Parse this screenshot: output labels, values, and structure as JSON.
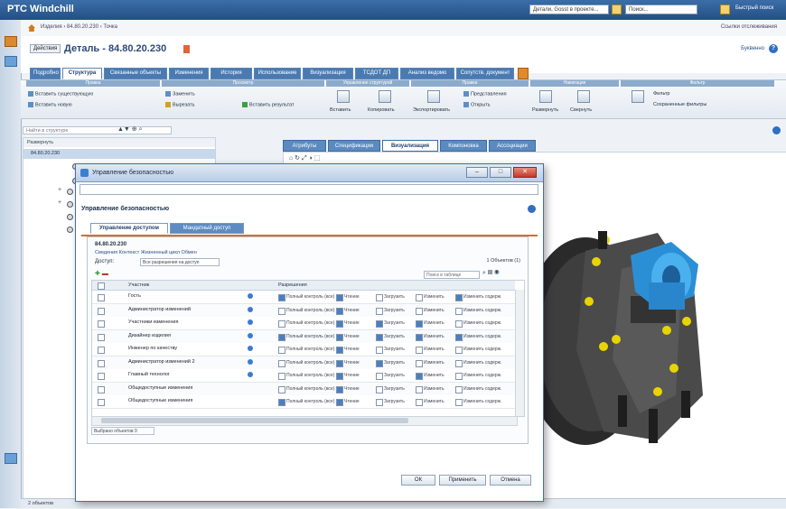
{
  "app": {
    "brand": "PTC Windchill"
  },
  "topbar": {
    "field1": "Детали, Gosst в проекте...",
    "field2": "Поиск...",
    "quicksearch": "Быстрый поиск"
  },
  "breadcrumb": {
    "text": "Изделия › 84.80.20.230 › Точка",
    "right": "Ссылки отслеживания"
  },
  "title": {
    "actions": "Действия",
    "text": "Деталь - 84.80.20.230",
    "alpha": "Буквенно"
  },
  "tabs": [
    "Подробно",
    "Структура",
    "Связанные объекты",
    "Изменения",
    "История",
    "Использование",
    "Визуализация",
    "ТСДОТ ДП",
    "Анализ ведомо",
    "Сопутств. документ"
  ],
  "ribbon": {
    "groups": [
      "Правка",
      "Просмотр",
      "Управление структурой",
      "Правка",
      "Навигация",
      "Фильтр"
    ],
    "items": {
      "insert_existing": "Вставить существующую",
      "insert_new": "Вставить новую",
      "replace": "Заменить",
      "cut": "Вырезать",
      "paste": "Вставить",
      "copy": "Копировать",
      "export": "Экспортировать",
      "open": "Открыть",
      "insert_result": "Вставить результат",
      "view": "Представления",
      "expand": "Развернуть",
      "collapse": "Свернуть",
      "filter": "Фильтр",
      "saved_filters": "Сохраненные фильтры"
    }
  },
  "left": {
    "search_placeholder": "Найти в структуре",
    "tree_header": "Развернуть",
    "tree_root": "84.80.20.230"
  },
  "right_tabs": [
    "Атрибуты",
    "Спецификации",
    "Визуализация",
    "Компоновка",
    "Ассоциации"
  ],
  "statusbar": "2 объектов",
  "dialog": {
    "title": "Управление безопасностью",
    "heading": "Управление безопасностью",
    "tabs": [
      "Управление доступом",
      "Мандатный доступ"
    ],
    "object": "84.80.20.230",
    "links": "Сведения  Контекст  Жизненный цикл  Обмен",
    "access_label": "Доступ:",
    "access_value": "Все разрешения на доступ",
    "obj_count": "1 Объектов (1)",
    "search_placeholder": "Поиск в таблице",
    "columns": {
      "name": "Участник",
      "perm": "Разрешения"
    },
    "perm_labels": [
      "Полный контроль (все)",
      "Чтение",
      "Загрузить",
      "Изменить",
      "Изменить содерж."
    ],
    "rows": [
      {
        "name": "Гость"
      },
      {
        "name": "Администратор изменений"
      },
      {
        "name": "Участники изменения"
      },
      {
        "name": "Дизайнер изделия"
      },
      {
        "name": "Инженер по качеству"
      },
      {
        "name": "Администратор изменений 2"
      },
      {
        "name": "Главный технолог"
      },
      {
        "name": "Общедоступные изменения"
      },
      {
        "name": "Общедоступные изменения"
      }
    ],
    "sel_count": "Выбрано объектов 0",
    "buttons": {
      "ok": "ОК",
      "apply": "Применить",
      "cancel": "Отмена"
    }
  }
}
